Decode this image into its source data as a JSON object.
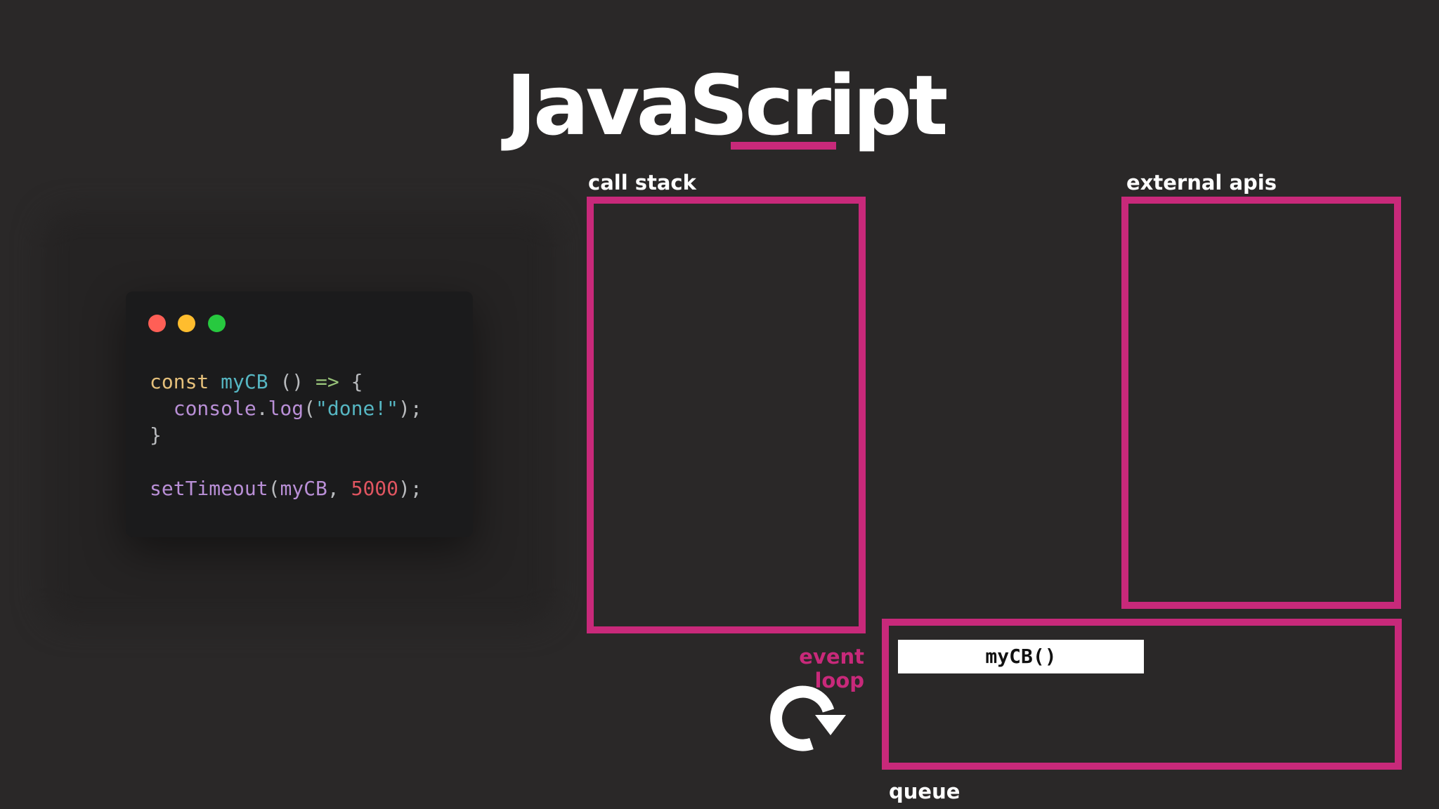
{
  "title": "JavaScript",
  "code": {
    "lines": [
      [
        {
          "t": "const ",
          "c": "tk-kw"
        },
        {
          "t": "myCB",
          "c": "tk-fn"
        },
        {
          "t": " () ",
          "c": "tk-punc"
        },
        {
          "t": "=>",
          "c": "tk-arrow"
        },
        {
          "t": " {",
          "c": "tk-punc"
        }
      ],
      [
        {
          "t": "  console",
          "c": "tk-method"
        },
        {
          "t": ".",
          "c": "tk-punc"
        },
        {
          "t": "log",
          "c": "tk-method"
        },
        {
          "t": "(",
          "c": "tk-punc"
        },
        {
          "t": "\"done!\"",
          "c": "tk-str"
        },
        {
          "t": ");",
          "c": "tk-punc"
        }
      ],
      [
        {
          "t": "}",
          "c": "tk-punc"
        }
      ],
      [],
      [
        {
          "t": "setTimeout",
          "c": "tk-method"
        },
        {
          "t": "(",
          "c": "tk-punc"
        },
        {
          "t": "myCB",
          "c": "tk-method"
        },
        {
          "t": ", ",
          "c": "tk-punc"
        },
        {
          "t": "5000",
          "c": "tk-num"
        },
        {
          "t": ");",
          "c": "tk-punc"
        }
      ]
    ]
  },
  "call_stack": {
    "label": "call stack",
    "items": []
  },
  "external_apis": {
    "label": "external apis",
    "items": []
  },
  "event_loop": {
    "label": "event loop",
    "icon": "loop-arrow-icon"
  },
  "queue": {
    "label": "queue",
    "items": [
      "myCB()"
    ]
  },
  "colors": {
    "accent": "#c8297a",
    "background": "#2a2828",
    "code_background": "#1b1b1c"
  }
}
